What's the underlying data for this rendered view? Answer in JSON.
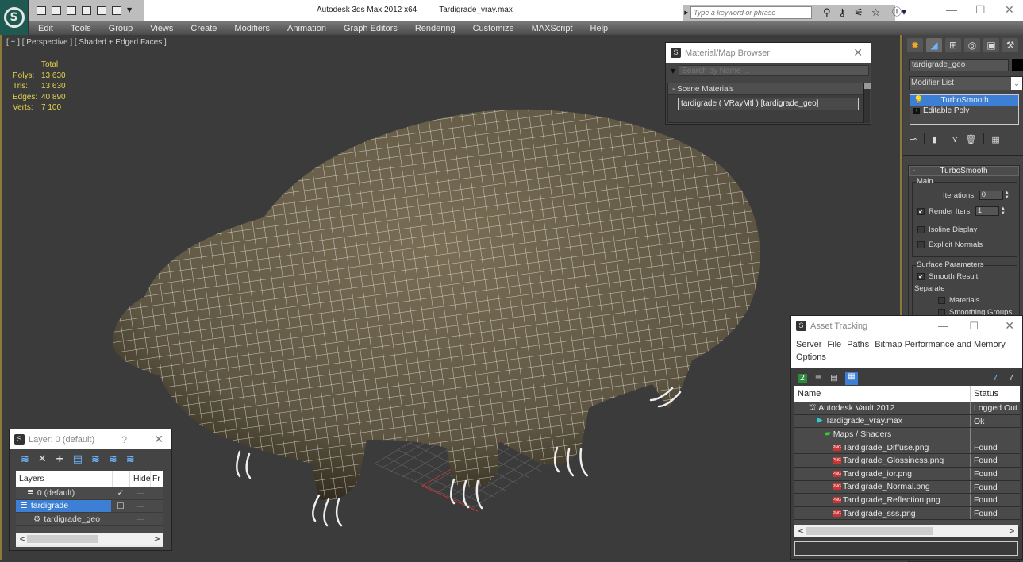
{
  "window": {
    "app_title": "Autodesk 3ds Max  2012 x64",
    "file_name": "Tardigrade_vray.max",
    "search_placeholder": "Type a keyword or phrase",
    "help_label": "?",
    "minimize": "—",
    "maximize": "☐",
    "close": "✕"
  },
  "menu": [
    "Edit",
    "Tools",
    "Group",
    "Views",
    "Create",
    "Modifiers",
    "Animation",
    "Graph Editors",
    "Rendering",
    "Customize",
    "MAXScript",
    "Help"
  ],
  "viewport": {
    "label": "[ + ] [ Perspective ] [ Shaded + Edged Faces ]",
    "stats_header": "Total",
    "stats": [
      {
        "key": "Polys:",
        "value": "13 630"
      },
      {
        "key": "Tris:",
        "value": "13 630"
      },
      {
        "key": "Edges:",
        "value": "40 890"
      },
      {
        "key": "Verts:",
        "value": "7 100"
      }
    ],
    "colors": {
      "background": "#3b3b3b",
      "mesh_fill": "#6a604a",
      "wire": "#f2f2f2",
      "frame": "#8a7a3c"
    }
  },
  "material_browser": {
    "title": "Material/Map Browser",
    "search_placeholder": "Search by Name ...",
    "section": "- Scene Materials",
    "items": [
      "tardigrade  ( VRayMtl ) [tardigrade_geo]"
    ]
  },
  "command_panel": {
    "object_name": "tardigrade_geo",
    "modifier_list": "Modifier List",
    "stack": [
      {
        "label": "TurboSmooth",
        "selected": true
      },
      {
        "label": "Editable Poly",
        "selected": false
      }
    ],
    "rollout_title": "TurboSmooth",
    "main_group": "Main",
    "iterations_label": "Iterations:",
    "iterations_value": "0",
    "render_iters_label": "Render Iters:",
    "render_iters_value": "1",
    "render_iters_checked": true,
    "isoline_display": "Isoline Display",
    "explicit_normals": "Explicit Normals",
    "surface_group": "Surface Parameters",
    "smooth_result": "Smooth Result",
    "separate": "Separate",
    "materials": "Materials",
    "smoothing_groups": "Smoothing Groups"
  },
  "asset_tracking": {
    "title": "Asset Tracking",
    "menu": [
      "Server",
      "File",
      "Paths",
      "Bitmap Performance and Memory",
      "Options"
    ],
    "columns": {
      "name": "Name",
      "status": "Status"
    },
    "rows": [
      {
        "name": "Autodesk Vault 2012",
        "status": "Logged Out",
        "indent": 1,
        "icon": "vault"
      },
      {
        "name": "Tardigrade_vray.max",
        "status": "Ok",
        "indent": 2,
        "icon": "max"
      },
      {
        "name": "Maps / Shaders",
        "status": "",
        "indent": 3,
        "icon": "maps"
      },
      {
        "name": "Tardigrade_Diffuse.png",
        "status": "Found",
        "indent": 4,
        "icon": "png"
      },
      {
        "name": "Tardigrade_Glossiness.png",
        "status": "Found",
        "indent": 4,
        "icon": "png"
      },
      {
        "name": "Tardigrade_ior.png",
        "status": "Found",
        "indent": 4,
        "icon": "png"
      },
      {
        "name": "Tardigrade_Normal.png",
        "status": "Found",
        "indent": 4,
        "icon": "png"
      },
      {
        "name": "Tardigrade_Reflection.png",
        "status": "Found",
        "indent": 4,
        "icon": "png"
      },
      {
        "name": "Tardigrade_sss.png",
        "status": "Found",
        "indent": 4,
        "icon": "png"
      }
    ]
  },
  "layer_panel": {
    "title": "Layer: 0 (default)",
    "help": "?",
    "columns": {
      "name": "Layers",
      "hide": "Hide",
      "freeze": "Fr"
    },
    "rows": [
      {
        "name": "0 (default)",
        "current": "✓",
        "selected": false,
        "indent": 1
      },
      {
        "name": "tardigrade",
        "current": "☐",
        "selected": true,
        "indent": 0
      },
      {
        "name": "tardigrade_geo",
        "current": "",
        "selected": false,
        "indent": 2
      }
    ]
  }
}
